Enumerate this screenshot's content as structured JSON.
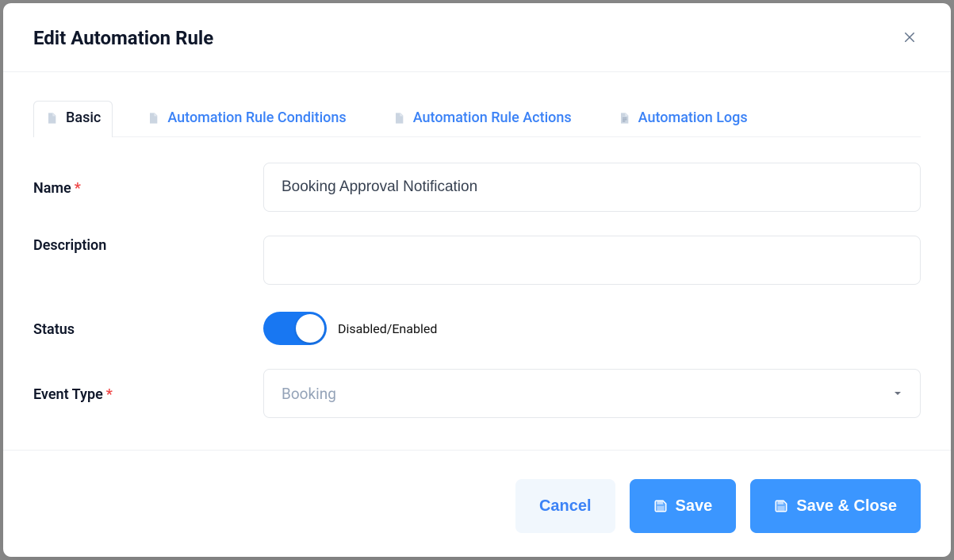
{
  "modal": {
    "title": "Edit Automation Rule"
  },
  "tabs": [
    {
      "label": "Basic"
    },
    {
      "label": "Automation Rule Conditions"
    },
    {
      "label": "Automation Rule Actions"
    },
    {
      "label": "Automation Logs"
    }
  ],
  "form": {
    "name_label": "Name",
    "name_value": "Booking Approval Notification",
    "description_label": "Description",
    "description_value": "",
    "status_label": "Status",
    "status_toggle_text": "Disabled/Enabled",
    "event_type_label": "Event Type",
    "event_type_value": "Booking"
  },
  "footer": {
    "cancel": "Cancel",
    "save": "Save",
    "save_close": "Save & Close"
  }
}
